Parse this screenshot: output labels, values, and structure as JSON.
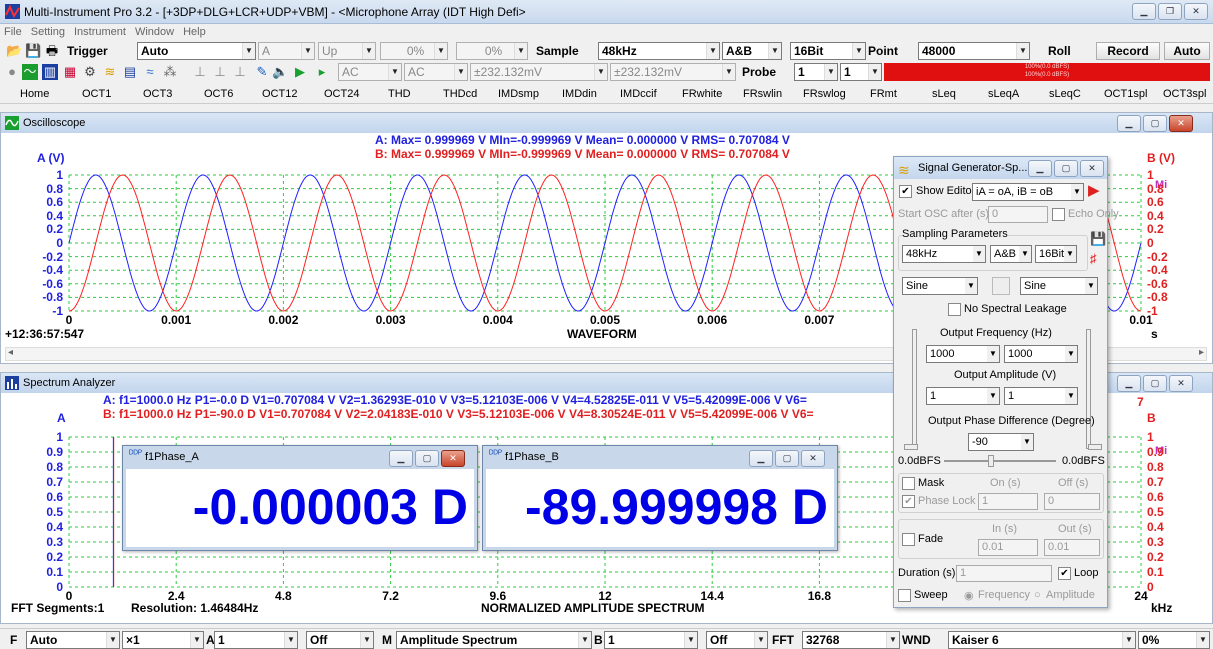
{
  "window": {
    "title": "Multi-Instrument Pro 3.2  -  [+3DP+DLG+LCR+UDP+VBM]  -  <Microphone Array (IDT High Defi>"
  },
  "menu": [
    "File",
    "Setting",
    "Instrument",
    "Window",
    "Help"
  ],
  "toolbar1": {
    "trigger_label": "Trigger",
    "trigger_mode": "Auto",
    "trigger_channel": "A",
    "trigger_edge": "Up",
    "pct1": "0%",
    "pct2": "0%",
    "sample_label": "Sample",
    "sample_rate": "48kHz",
    "channel": "A&B",
    "bits": "16Bit",
    "point_label": "Point",
    "points": "48000",
    "roll_label": "Roll",
    "record_label": "Record",
    "auto_label": "Auto"
  },
  "toolbar2": {
    "coupling_a": "AC",
    "coupling_b": "AC",
    "range_a": "±232.132mV",
    "range_b": "±232.132mV",
    "probe_label": "Probe",
    "probe_a": "1",
    "probe_b": "1",
    "level_a": "100%(0.0 dBFS)",
    "level_b": "100%(0.0 dBFS)"
  },
  "tabs": [
    "Home",
    "OCT1",
    "OCT3",
    "OCT6",
    "OCT12",
    "OCT24",
    "THD",
    "THDcd",
    "IMDsmp",
    "IMDdin",
    "IMDccif",
    "FRwhite",
    "FRswlin",
    "FRswlog",
    "FRmt",
    "sLeq",
    "sLeqA",
    "sLeqC",
    "OCT1spl",
    "OCT3spl"
  ],
  "osc": {
    "title": "Oscilloscope",
    "stats_a": "A: Max= 0.999969 V  MIn=-0.999969 V  Mean= 0.000000 V  RMS= 0.707084 V",
    "stats_b": "B: Max= 0.999969 V  MIn=-0.999969 V  Mean= 0.000000 V  RMS= 0.707084 V",
    "axis_a": "A (V)",
    "axis_b": "B (V)",
    "yticks": [
      "1",
      "0.8",
      "0.6",
      "0.4",
      "0.2",
      "0",
      "-0.2",
      "-0.4",
      "-0.6",
      "-0.8",
      "-1"
    ],
    "xticks": [
      "0",
      "0.001",
      "0.002",
      "0.003",
      "0.004",
      "0.005",
      "0.006",
      "0.007",
      "0.01"
    ],
    "xunit": "s",
    "xlabel": "WAVEFORM",
    "timestamp": "+12:36:57:547",
    "mi": "Mi"
  },
  "spec": {
    "title": "Spectrum Analyzer",
    "stats_a": "A: f1=1000.0 Hz  P1=-0.0 D  V1=0.707084 V  V2=1.36293E-010 V  V3=5.12103E-006 V  V4=4.52825E-011 V  V5=5.42099E-006 V  V6=",
    "stats_b": "B: f1=1000.0 Hz  P1=-90.0 D  V1=0.707084 V  V2=2.04183E-010 V  V3=5.12103E-006 V  V4=8.30524E-011 V  V5=5.42099E-006 V  V6=",
    "axis_a": "A",
    "axis_b": "B",
    "yticks": [
      "1",
      "0.9",
      "0.8",
      "0.7",
      "0.6",
      "0.5",
      "0.4",
      "0.3",
      "0.2",
      "0.1",
      "0"
    ],
    "xticks": [
      "0",
      "2.4",
      "4.8",
      "7.2",
      "9.6",
      "12",
      "14.4",
      "16.8",
      "24"
    ],
    "xunit": "kHz",
    "xlabel": "NORMALIZED AMPLITUDE SPECTRUM",
    "fft_segments": "FFT Segments:1",
    "resolution": "Resolution: 1.46484Hz",
    "mi": "Mi",
    "bg_digit": "7"
  },
  "meters": [
    {
      "title": "f1Phase_A",
      "value": "-0.000003 D"
    },
    {
      "title": "f1Phase_B",
      "value": "-89.999998 D"
    }
  ],
  "siggen": {
    "title": "Signal Generator-Sp...",
    "show_editor": "Show Editor",
    "editor_expr": "iA = oA, iB = oB",
    "start_osc": "Start OSC after (s)",
    "start_osc_val": "0",
    "echo_only": "Echo Only",
    "sampling_params": "Sampling Parameters",
    "rate": "48kHz",
    "chan": "A&B",
    "bits": "16Bit",
    "wave_a": "Sine",
    "wave_b": "Sine",
    "no_leak": "No Spectral Leakage",
    "out_freq": "Output Frequency (Hz)",
    "freq_a": "1000",
    "freq_b": "1000",
    "out_amp": "Output Amplitude (V)",
    "amp_a": "1",
    "amp_b": "1",
    "out_phase": "Output Phase Difference (Degree)",
    "phase": "-90",
    "dbfs_l": "0.0dBFS",
    "dbfs_r": "0.0dBFS",
    "mask": "Mask",
    "on_s": "On (s)",
    "off_s": "Off (s)",
    "phase_lock": "Phase Lock",
    "mask_on": "1",
    "mask_off": "0",
    "fade": "Fade",
    "in_s": "In (s)",
    "out_s": "Out (s)",
    "fade_in": "0.01",
    "fade_out": "0.01",
    "duration": "Duration (s)",
    "duration_val": "1",
    "loop": "Loop",
    "sweep": "Sweep",
    "frequency": "Frequency",
    "amplitude": "Amplitude"
  },
  "status": {
    "f_label": "F",
    "f_val": "Auto",
    "x_val": "×1",
    "a_label": "A",
    "a_val": "1",
    "a_off": "Off",
    "m_label": "M",
    "m_val": "Amplitude Spectrum",
    "b_label": "B",
    "b_val": "1",
    "b_off": "Off",
    "fft_label": "FFT",
    "fft_val": "32768",
    "wnd_label": "WND",
    "wnd_val": "Kaiser 6",
    "pct": "0%"
  }
}
